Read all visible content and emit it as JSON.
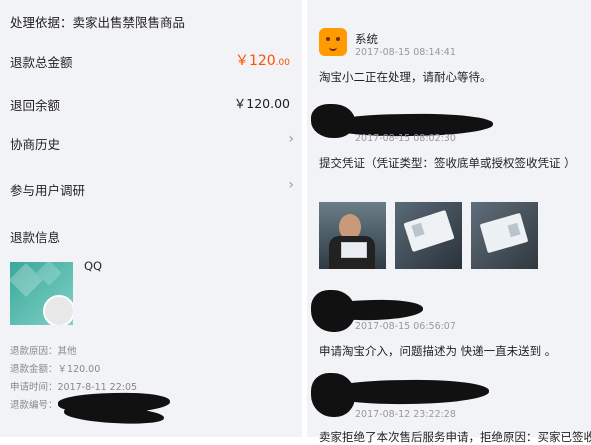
{
  "left": {
    "basis": "处理依据：卖家出售禁限售商品",
    "total": {
      "label": "退款总金额",
      "symbol": "￥",
      "int": "120",
      "dec": ".00"
    },
    "returned": {
      "label": "退回余额",
      "symbol": "￥",
      "int": "120",
      "dec": ".00"
    },
    "history": {
      "label": "协商历史",
      "chevron": "›"
    },
    "survey": {
      "label": "参与用户调研",
      "chevron": "›"
    },
    "info": {
      "title": "退款信息",
      "item_name": "QQ",
      "reason": "退款原因：其他",
      "amount": "退款金额：￥120.00",
      "time": "申请时间：2017-8-11 22:05",
      "number": "退款编号："
    }
  },
  "right": {
    "messages": [
      {
        "sender": "系统",
        "time": "2017-08-15 08:14:41",
        "text": "淘宝小二正在处理，请耐心等待。"
      },
      {
        "time": "2017-08-15 08:02:30",
        "text": "提交凭证（凭证类型：签收底单或授权签收凭证 ）"
      },
      {
        "time": "2017-08-15 06:56:07",
        "text": "申请淘宝介入，问题描述为 快递一直未送到 。"
      },
      {
        "time": "2017-08-12 23:22:28",
        "text": "卖家拒绝了本次售后服务申请，拒绝原因：买家已签收"
      }
    ],
    "icons": {
      "system_avatar": "taobao-mascot-icon",
      "chevron": "chevron-right-icon"
    }
  },
  "colors": {
    "accent": "#ff5000",
    "background": "#f2f3f7",
    "muted": "#999999"
  }
}
